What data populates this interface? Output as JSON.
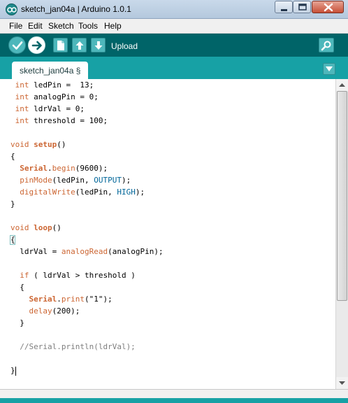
{
  "window": {
    "title": "sketch_jan04a | Arduino 1.0.1",
    "app_icon": "arduino-logo-icon",
    "controls": [
      "minimize-icon",
      "maximize-icon",
      "close-icon"
    ]
  },
  "menu": {
    "items": [
      {
        "label": "File"
      },
      {
        "label": "Edit"
      },
      {
        "label": "Sketch"
      },
      {
        "label": "Tools"
      },
      {
        "label": "Help"
      }
    ]
  },
  "toolbar": {
    "hover_label": "Upload",
    "buttons": [
      {
        "name": "verify",
        "icon": "checkmark-icon"
      },
      {
        "name": "upload",
        "icon": "right-arrow-icon"
      },
      {
        "name": "new",
        "icon": "new-file-icon"
      },
      {
        "name": "open",
        "icon": "up-arrow-icon"
      },
      {
        "name": "save",
        "icon": "down-arrow-icon"
      },
      {
        "name": "serial-monitor",
        "icon": "magnifier-icon"
      }
    ]
  },
  "tabs": {
    "items": [
      {
        "label": "sketch_jan04a §",
        "active": true
      }
    ],
    "menu_icon": "triangle-down-icon"
  },
  "editor": {
    "lines": [
      "int ledPin =  13;",
      "int analogPin = 0;",
      "int ldrVal = 0;",
      "int threshold = 100;",
      "",
      "void setup()",
      "{",
      "  Serial.begin(9600);",
      "  pinMode(ledPin, OUTPUT);",
      "  digitalWrite(ledPin, HIGH);",
      "}",
      "",
      "void loop()",
      "{",
      "  ldrVal = analogRead(analogPin);",
      "",
      "  if ( ldrVal > threshold )",
      "  {",
      "    Serial.print(\"1\");",
      "    delay(200);",
      "  }",
      "",
      "  //Serial.println(ldrVal);",
      "",
      "}"
    ]
  },
  "colors": {
    "toolbar_bg": "#006468",
    "tabbar_bg": "#17a1a5",
    "button_bg": "#4db7bb",
    "keyword": "#cc6633",
    "constant": "#006699",
    "comment": "#7e7e7e"
  }
}
